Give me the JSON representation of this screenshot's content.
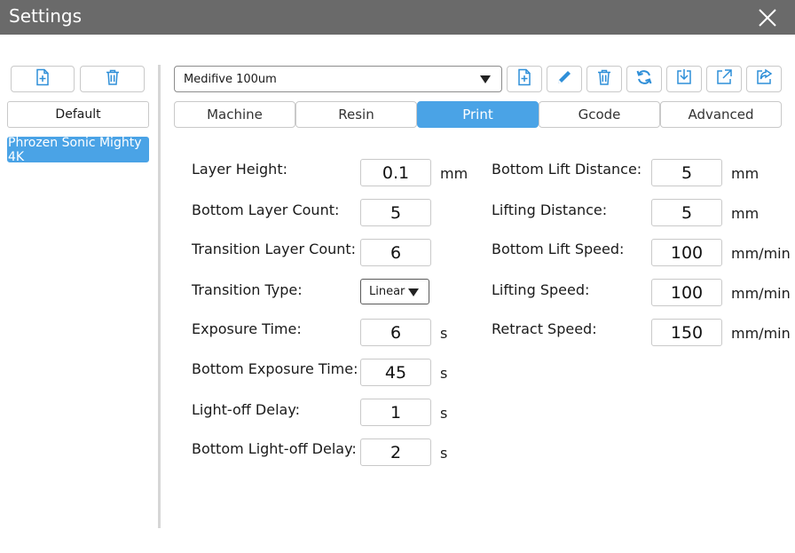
{
  "window": {
    "title": "Settings"
  },
  "profiles": {
    "items": [
      {
        "label": "Default"
      },
      {
        "label": "Phrozen Sonic Mighty 4K"
      }
    ],
    "selected_color": "#4aa3e6"
  },
  "toolbar": {
    "preset": "Medifive 100um",
    "icons": [
      "new-file-icon",
      "edit-pencil-icon",
      "delete-trash-icon",
      "refresh-icon",
      "import-icon",
      "export-icon",
      "share-icon"
    ],
    "icon_color": "#2f8fd8"
  },
  "tabs": [
    {
      "label": "Machine"
    },
    {
      "label": "Resin"
    },
    {
      "label": "Print"
    },
    {
      "label": "Gcode"
    },
    {
      "label": "Advanced"
    }
  ],
  "left_params": [
    {
      "label": "Layer Height:",
      "value": "0.1",
      "unit": "mm"
    },
    {
      "label": "Bottom Layer Count:",
      "value": "5",
      "unit": ""
    },
    {
      "label": "Transition Layer Count:",
      "value": "6",
      "unit": ""
    },
    {
      "label": "Transition Type:",
      "value": "Linear",
      "unit": ""
    },
    {
      "label": "Exposure Time:",
      "value": "6",
      "unit": "s"
    },
    {
      "label": "Bottom Exposure Time:",
      "value": "45",
      "unit": "s"
    },
    {
      "label": "Light-off Delay:",
      "value": "1",
      "unit": "s"
    },
    {
      "label": "Bottom Light-off Delay:",
      "value": "2",
      "unit": "s"
    }
  ],
  "right_params": [
    {
      "label": "Bottom Lift Distance:",
      "value": "5",
      "unit": "mm"
    },
    {
      "label": "Lifting Distance:",
      "value": "5",
      "unit": "mm"
    },
    {
      "label": "Bottom Lift Speed:",
      "value": "100",
      "unit": "mm/min"
    },
    {
      "label": "Lifting Speed:",
      "value": "100",
      "unit": "mm/min"
    },
    {
      "label": "Retract Speed:",
      "value": "150",
      "unit": "mm/min"
    }
  ]
}
